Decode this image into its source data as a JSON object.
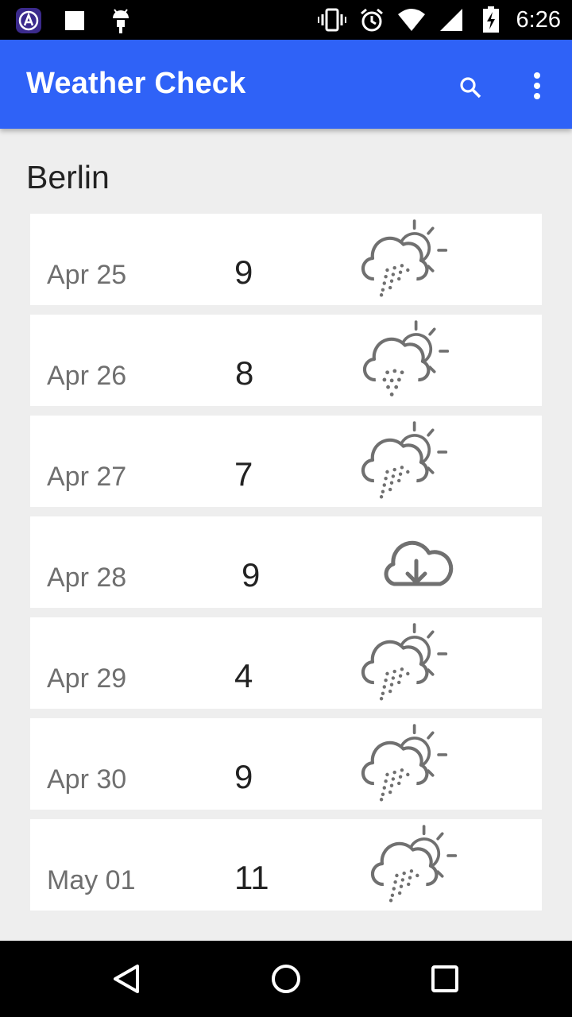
{
  "status_bar": {
    "time": "6:26",
    "left_icons": [
      "app-launcher-icon",
      "square-notification-icon",
      "android-debug-icon"
    ],
    "right_icons": [
      "vibrate-icon",
      "alarm-icon",
      "wifi-icon",
      "signal-icon",
      "battery-charging-icon"
    ]
  },
  "app_bar": {
    "title": "Weather Check",
    "color": "#2f62f7",
    "actions": [
      "search-icon",
      "more-vert-icon"
    ]
  },
  "location": "Berlin",
  "forecast": [
    {
      "date": "Apr 25",
      "temp": "9",
      "icon": "rain-sun-icon"
    },
    {
      "date": "Apr 26",
      "temp": "8",
      "icon": "snow-sun-icon"
    },
    {
      "date": "Apr 27",
      "temp": "7",
      "icon": "rain-sun-icon"
    },
    {
      "date": "Apr 28",
      "temp": "9",
      "icon": "cloud-download-icon"
    },
    {
      "date": "Apr 29",
      "temp": "4",
      "icon": "rain-sun-icon"
    },
    {
      "date": "Apr 30",
      "temp": "9",
      "icon": "rain-sun-icon"
    },
    {
      "date": "May 01",
      "temp": "11",
      "icon": "rain-sun-icon"
    }
  ],
  "nav_bar": {
    "buttons": [
      "back-icon",
      "home-icon",
      "recents-icon"
    ]
  }
}
